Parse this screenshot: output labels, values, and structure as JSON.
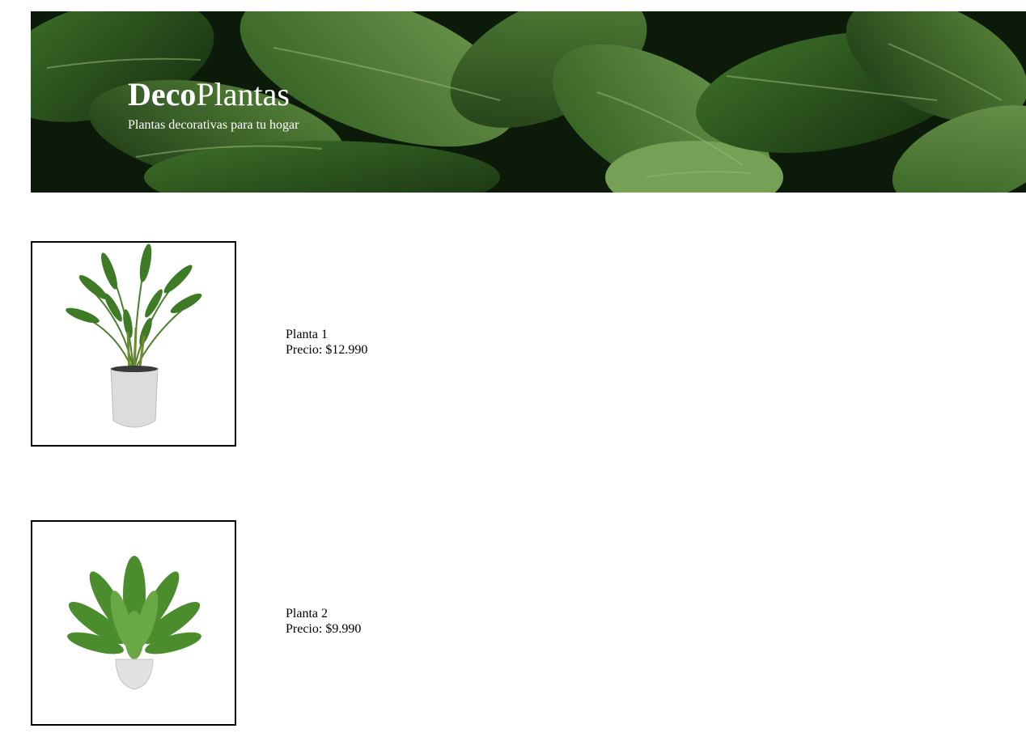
{
  "header": {
    "brand_bold": "Deco",
    "brand_regular": "Plantas",
    "tagline": "Plantas decorativas para tu hogar",
    "background_image": "green-leaves-image"
  },
  "products": [
    {
      "name": "Planta 1",
      "price_label": "Precio: $12.990",
      "image": "areca-palm-in-white-pot-image"
    },
    {
      "name": "Planta 2",
      "price_label": "Precio: $9.990",
      "image": "fern-in-white-pot-image"
    }
  ],
  "colors": {
    "header_text": "#ffffff",
    "leaf_dark": "#1f4418",
    "leaf_light": "#5f9a3c",
    "pot": "#dcdcdc",
    "border": "#000000"
  }
}
